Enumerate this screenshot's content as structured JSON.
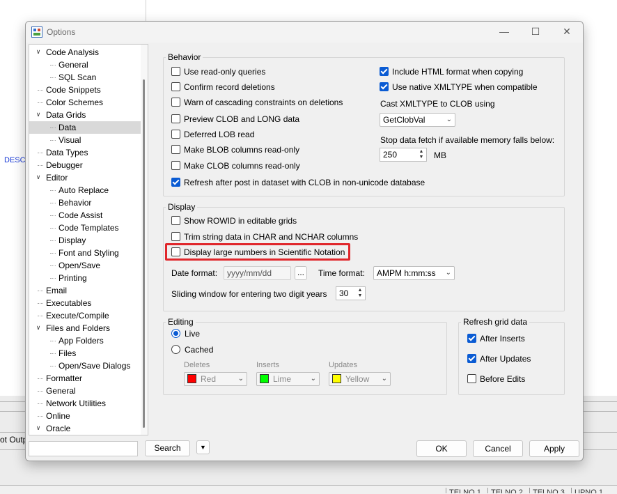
{
  "background": {
    "desc_text": "DESC",
    "tab_label": "ot Outp",
    "status_cells": [
      "TELNO 1",
      "TELNO 2",
      "TELNO 3",
      "UPNO 1"
    ]
  },
  "window": {
    "title": "Options"
  },
  "tree": {
    "items": [
      {
        "label": "Code Analysis",
        "level": 0,
        "expander": "collapse"
      },
      {
        "label": "General",
        "level": 1
      },
      {
        "label": "SQL Scan",
        "level": 1
      },
      {
        "label": "Code Snippets",
        "level": 0
      },
      {
        "label": "Color Schemes",
        "level": 0
      },
      {
        "label": "Data Grids",
        "level": 0,
        "expander": "collapse"
      },
      {
        "label": "Data",
        "level": 1,
        "selected": true
      },
      {
        "label": "Visual",
        "level": 1
      },
      {
        "label": "Data Types",
        "level": 0
      },
      {
        "label": "Debugger",
        "level": 0
      },
      {
        "label": "Editor",
        "level": 0,
        "expander": "collapse"
      },
      {
        "label": "Auto Replace",
        "level": 1
      },
      {
        "label": "Behavior",
        "level": 1
      },
      {
        "label": "Code Assist",
        "level": 1
      },
      {
        "label": "Code Templates",
        "level": 1
      },
      {
        "label": "Display",
        "level": 1
      },
      {
        "label": "Font and Styling",
        "level": 1
      },
      {
        "label": "Open/Save",
        "level": 1
      },
      {
        "label": "Printing",
        "level": 1
      },
      {
        "label": "Email",
        "level": 0
      },
      {
        "label": "Executables",
        "level": 0
      },
      {
        "label": "Execute/Compile",
        "level": 0
      },
      {
        "label": "Files and Folders",
        "level": 0,
        "expander": "collapse"
      },
      {
        "label": "App Folders",
        "level": 1
      },
      {
        "label": "Files",
        "level": 1
      },
      {
        "label": "Open/Save Dialogs",
        "level": 1
      },
      {
        "label": "Formatter",
        "level": 0
      },
      {
        "label": "General",
        "level": 0
      },
      {
        "label": "Network Utilities",
        "level": 0
      },
      {
        "label": "Online",
        "level": 0
      },
      {
        "label": "Oracle",
        "level": 0,
        "expander": "collapse"
      }
    ]
  },
  "behavior": {
    "title": "Behavior",
    "left_options": [
      {
        "label": "Use read-only queries",
        "checked": false
      },
      {
        "label": "Confirm record deletions",
        "checked": false
      },
      {
        "label": "Warn of cascading constraints on deletions",
        "checked": false
      },
      {
        "label": "Preview CLOB and LONG data",
        "checked": false
      },
      {
        "label": "Deferred LOB read",
        "checked": false
      },
      {
        "label": "Make BLOB columns read-only",
        "checked": false
      },
      {
        "label": "Make CLOB columns read-only",
        "checked": false
      }
    ],
    "right_options": [
      {
        "label": "Include HTML format when copying",
        "checked": true
      },
      {
        "label": "Use native XMLTYPE when compatible",
        "checked": true
      }
    ],
    "cast_label": "Cast XMLTYPE to CLOB using",
    "cast_value": "GetClobVal",
    "stop_fetch_label": "Stop data fetch if available memory falls below:",
    "stop_fetch_value": "250",
    "stop_fetch_unit": "MB",
    "refresh_clob": {
      "label": "Refresh after post in dataset with CLOB  in non-unicode database",
      "checked": true
    }
  },
  "display": {
    "title": "Display",
    "options": [
      {
        "label": "Show ROWID in editable grids",
        "checked": false
      },
      {
        "label": "Trim string data in CHAR and NCHAR columns",
        "checked": false
      },
      {
        "label": "Display large numbers in Scientific Notation",
        "checked": false
      }
    ],
    "date_format_label": "Date format:",
    "date_format_value": "yyyy/mm/dd",
    "browse_label": "...",
    "time_format_label": "Time format:",
    "time_format_value": "AMPM h:mm:ss",
    "sliding_label": "Sliding window for entering two digit years",
    "sliding_value": "30"
  },
  "editing": {
    "title": "Editing",
    "live_label": "Live",
    "cached_label": "Cached",
    "selected": "Live",
    "deletes_label": "Deletes",
    "deletes_value": "Red",
    "deletes_color": "#ff0000",
    "inserts_label": "Inserts",
    "inserts_value": "Lime",
    "inserts_color": "#00ff00",
    "updates_label": "Updates",
    "updates_value": "Yellow",
    "updates_color": "#ffff00"
  },
  "refresh_grid": {
    "title": "Refresh grid data",
    "options": [
      {
        "label": "After Inserts",
        "checked": true
      },
      {
        "label": "After Updates",
        "checked": true
      },
      {
        "label": "Before Edits",
        "checked": false
      }
    ]
  },
  "footer": {
    "search_label": "Search",
    "ok_label": "OK",
    "cancel_label": "Cancel",
    "apply_label": "Apply"
  }
}
